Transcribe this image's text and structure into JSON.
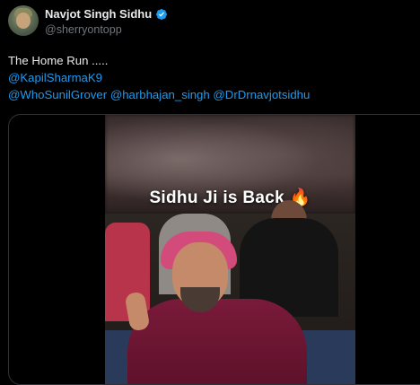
{
  "author": {
    "display_name": "Navjot Singh Sidhu",
    "handle": "@sherryontopp",
    "verified_color": "#1d9bf0"
  },
  "tweet": {
    "line1": "The Home Run .....",
    "mention1": "@KapilSharmaK9",
    "mentions_line": [
      "@WhoSunilGrover",
      "@harbhajan_singh",
      "@DrDrnavjotsidhu"
    ]
  },
  "media": {
    "caption": "Sidhu Ji is Back",
    "caption_emoji": "🔥"
  },
  "colors": {
    "background": "#000000",
    "text": "#e7e9ea",
    "secondary": "#71767b",
    "link": "#1d9bf0"
  }
}
